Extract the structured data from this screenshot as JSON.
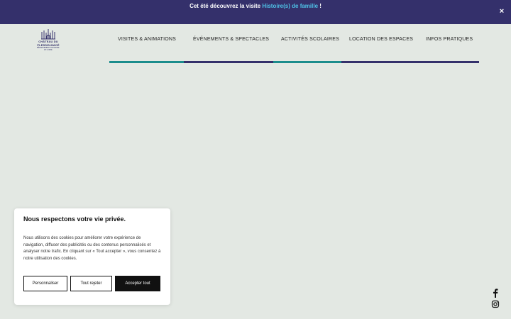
{
  "announcement": {
    "prefix": "Cet été découvrez la visite ",
    "link_text": "Histoire(s) de famille",
    "suffix": " !",
    "close_label": "×"
  },
  "logo": {
    "line1": "CHÂTEAU DU",
    "line2": "PLESSIS-MACÉ",
    "tagline": "DÉPARTEMENT DE MAINE-ET-LOIRE"
  },
  "nav": {
    "items": [
      {
        "label": "VISITES & ANIMATIONS",
        "underline_color": "#1b8c8c"
      },
      {
        "label": "ÉVÉNEMENTS & SPECTACLES",
        "underline_color": "#34306b"
      },
      {
        "label": "ACTIVITÉS SCOLAIRES",
        "underline_color": "#1b8c8c"
      },
      {
        "label": "LOCATION DES ESPACES",
        "underline_color": "#34306b"
      },
      {
        "label": "INFOS PRATIQUES",
        "underline_color": "#34306b"
      }
    ]
  },
  "cookie": {
    "title": "Nous respectons votre vie privée.",
    "body": "Nous utilisons des cookies pour améliorer votre expérience de navigation, diffuser des publicités ou des contenus personnalisés et analyser notre trafic. En cliquant sur « Tout accepter », vous consentez à notre utilisation des cookies.",
    "personalize_label": "Personnaliser",
    "reject_label": "Tout rejeter",
    "accept_label": "Accepter tout"
  },
  "social": [
    {
      "icon": "facebook-icon"
    },
    {
      "icon": "instagram-icon"
    }
  ],
  "colors": {
    "brand": "#34306b",
    "accent_teal": "#1b8c8c",
    "link": "#4fc3e8",
    "background": "#e3e8e3"
  }
}
